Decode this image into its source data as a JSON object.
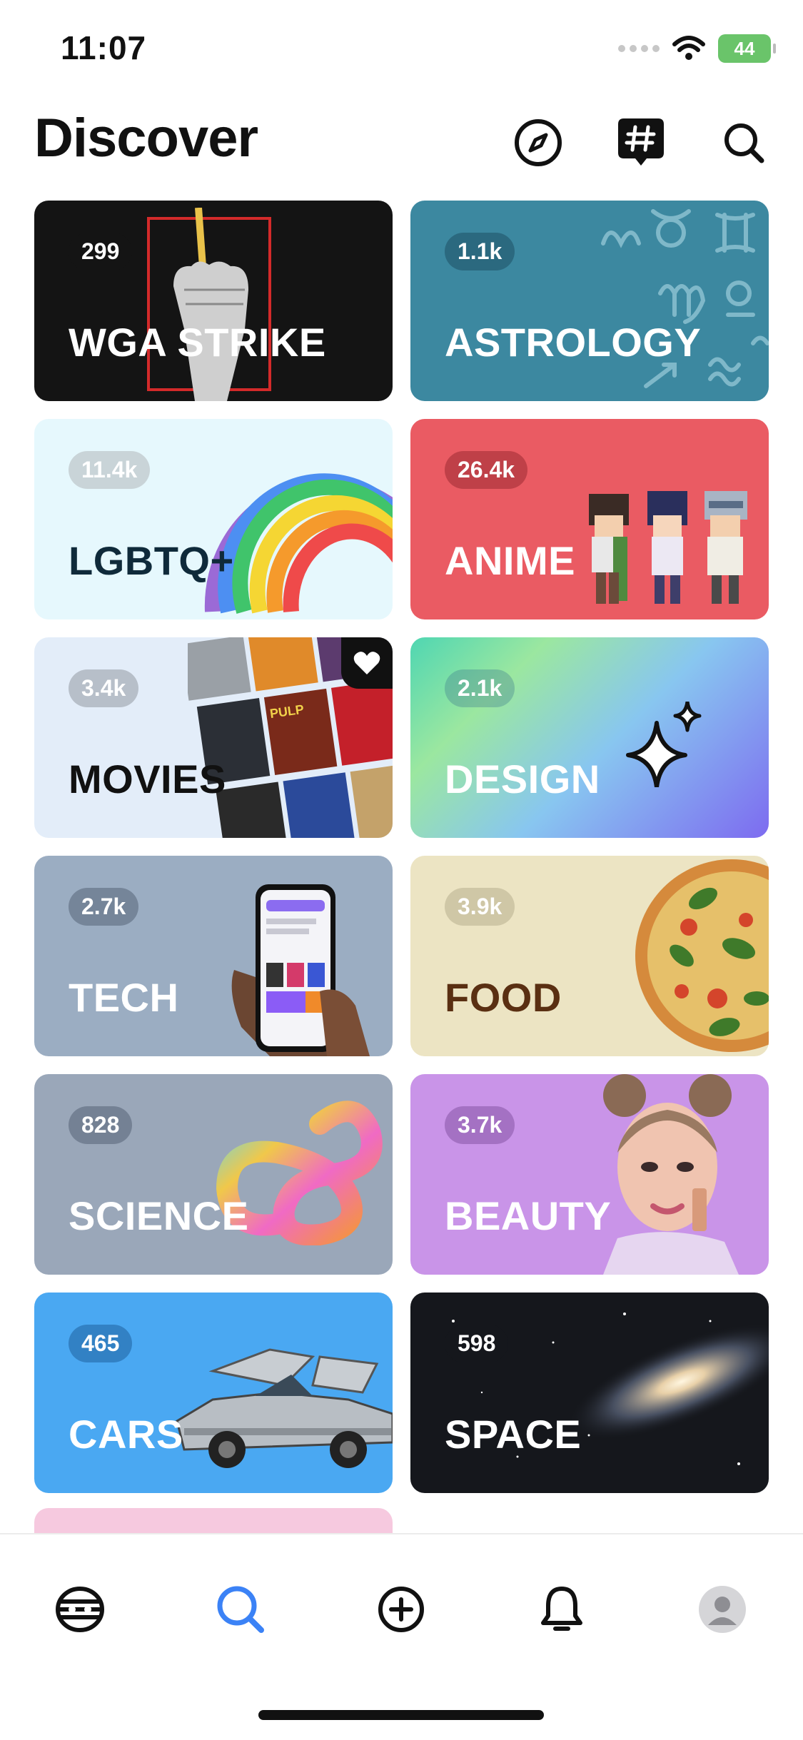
{
  "status": {
    "time": "11:07",
    "battery": "44"
  },
  "header": {
    "title": "Discover"
  },
  "icons": {
    "explore": "compass-icon",
    "topics": "hashtag-chat-icon",
    "search": "search-icon"
  },
  "colors": {
    "accent": "#3b82f6"
  },
  "cards": [
    {
      "title": "WGA STRIKE",
      "count": "299",
      "bg": "#141414",
      "title_color": "#ffffff"
    },
    {
      "title": "ASTROLOGY",
      "count": "1.1k",
      "bg": "#3c88a0",
      "title_color": "#ffffff"
    },
    {
      "title": "LGBTQ+",
      "count": "11.4k",
      "bg": "#e6f8fd",
      "title_color": "#0f2a3a"
    },
    {
      "title": "ANIME",
      "count": "26.4k",
      "bg": "#ea5b63",
      "title_color": "#ffffff"
    },
    {
      "title": "MOVIES",
      "count": "3.4k",
      "bg": "#e3edf9",
      "title_color": "#111111"
    },
    {
      "title": "DESIGN",
      "count": "2.1k",
      "bg": "#6ea7e6",
      "title_color": "#ffffff"
    },
    {
      "title": "TECH",
      "count": "2.7k",
      "bg": "#9badc2",
      "title_color": "#ffffff"
    },
    {
      "title": "FOOD",
      "count": "3.9k",
      "bg": "#ece4c3",
      "title_color": "#5a2f12"
    },
    {
      "title": "SCIENCE",
      "count": "828",
      "bg": "#9aa7b9",
      "title_color": "#ffffff"
    },
    {
      "title": "BEAUTY",
      "count": "3.7k",
      "bg": "#c994e8",
      "title_color": "#ffffff"
    },
    {
      "title": "CARS",
      "count": "465",
      "bg": "#4aa8f2",
      "title_color": "#ffffff"
    },
    {
      "title": "SPACE",
      "count": "598",
      "bg": "#15171c",
      "title_color": "#ffffff"
    }
  ],
  "tabbar": {
    "items": [
      "home-icon",
      "search-icon",
      "create-icon",
      "notifications-icon",
      "profile-icon"
    ],
    "active": "search"
  }
}
